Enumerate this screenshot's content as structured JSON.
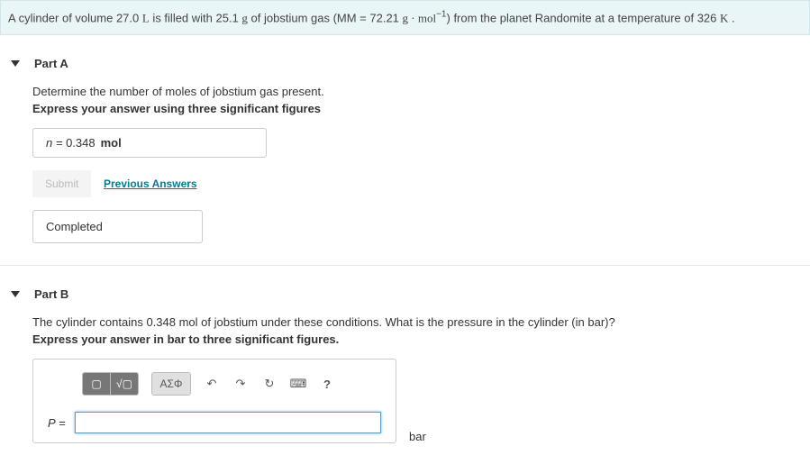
{
  "prompt": {
    "pre": "A cylinder of volume 27.0 ",
    "unit1": "L",
    "mid1": " is filled with 25.1 ",
    "unit2": "g",
    "mid2": " of jobstium gas (MM = 72.21 ",
    "unit3": "g · mol",
    "exp": "−1",
    "mid3": ") from the planet Randomite at a temperature of 326 ",
    "unit4": "K",
    "end": " ."
  },
  "partA": {
    "title": "Part A",
    "question": "Determine the number of moles of jobstium gas present.",
    "instruction": "Express your answer using three significant figures",
    "var": "n",
    "eq": " = ",
    "value": "0.348",
    "unit": "mol",
    "submit": "Submit",
    "prev": "Previous Answers",
    "status": "Completed"
  },
  "partB": {
    "title": "Part B",
    "question": "The cylinder contains 0.348 mol of jobstium under these conditions. What is the pressure in the cylinder (in bar)?",
    "instruction": "Express your answer in bar to three significant figures.",
    "toolbar": {
      "frac": "▢",
      "sqrt": "√▢",
      "greek": "ΑΣΦ",
      "undo": "↶",
      "redo": "↷",
      "reset": "↻",
      "keyb": "⌨",
      "help": "?"
    },
    "var": "P",
    "eq": " = ",
    "value": "",
    "unit": "bar"
  }
}
